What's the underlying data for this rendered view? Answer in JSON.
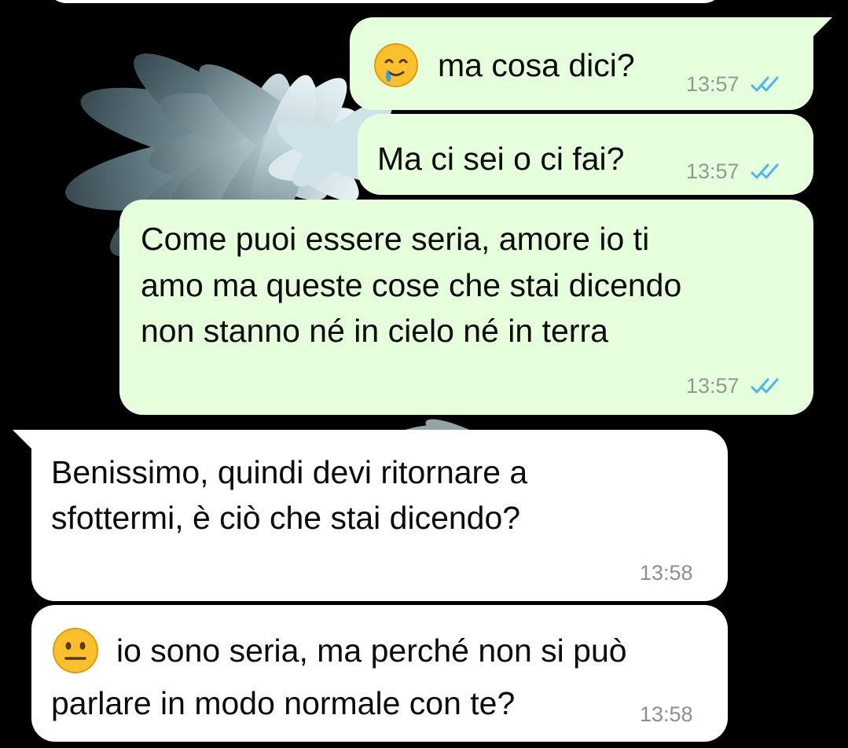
{
  "messages": [
    {
      "id": 1,
      "direction": "outgoing",
      "emoji": "smiling-face-with-tear-icon",
      "text": "ma cosa dici?",
      "time": "13:57",
      "status": "read"
    },
    {
      "id": 2,
      "direction": "outgoing",
      "text": "Ma ci sei o ci fai?",
      "time": "13:57",
      "status": "read"
    },
    {
      "id": 3,
      "direction": "outgoing",
      "lines": [
        "Come puoi essere seria, amore io ti",
        "amo ma queste cose che stai dicendo",
        "non stanno né in cielo né in terra"
      ],
      "time": "13:57",
      "status": "read"
    },
    {
      "id": 4,
      "direction": "incoming",
      "lines": [
        "Benissimo, quindi devi ritornare a",
        "sfottermi, è ciò che stai dicendo?"
      ],
      "time": "13:58"
    },
    {
      "id": 5,
      "direction": "incoming",
      "emoji": "neutral-face-icon",
      "lines": [
        "io sono seria, ma perché non si può",
        "parlare in modo normale con te?"
      ],
      "time": "13:58"
    }
  ],
  "colors": {
    "outgoing_bubble": "#e6ffdd",
    "incoming_bubble": "#ffffff",
    "read_ticks": "#4fb6ec",
    "timestamp": "#8f9a93",
    "wallpaper_background": "#000000"
  }
}
